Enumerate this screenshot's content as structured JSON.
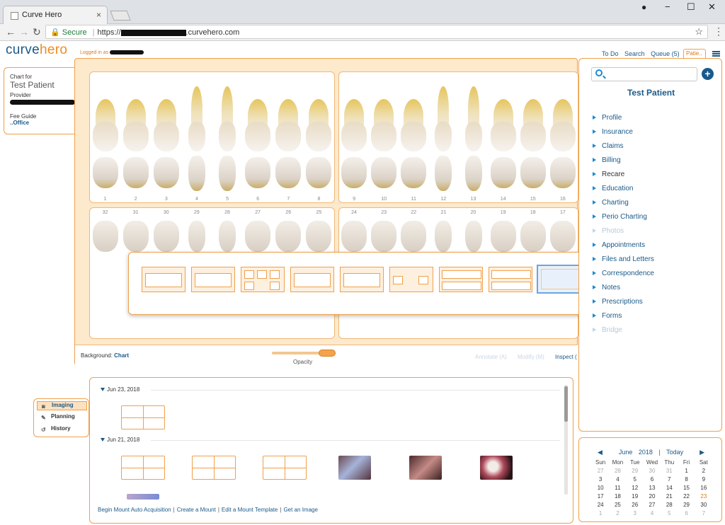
{
  "browser": {
    "tab_title": "Curve Hero",
    "tab_close": "×",
    "url_secure": "Secure",
    "url_proto": "https://",
    "url_domain": ".curvehero.com",
    "controls": [
      "−",
      "☐",
      "✕"
    ]
  },
  "app": {
    "logo_a": "curve",
    "logo_b": "hero",
    "logged_in": "Logged in as"
  },
  "topnav": {
    "todo": "To Do",
    "search": "Search",
    "queue": "Queue (5)",
    "patient_tab": "Patie.."
  },
  "chart_for": {
    "label": "Chart for",
    "patient": "Test Patient",
    "provider_label": "Provider",
    "fee_label": "Fee Guide",
    "fee_value": "..Office"
  },
  "tooth_numbers": {
    "upper": [
      "1",
      "2",
      "3",
      "4",
      "5",
      "6",
      "7",
      "8",
      "9",
      "10",
      "11",
      "12",
      "13",
      "14",
      "15",
      "16"
    ],
    "lower": [
      "32",
      "31",
      "30",
      "29",
      "28",
      "27",
      "26",
      "25",
      "24",
      "23",
      "22",
      "21",
      "20",
      "19",
      "18",
      "17"
    ]
  },
  "background": {
    "label": "Background:",
    "value": "Chart",
    "opacity_label": "Opacity",
    "opacity_level": 0.85
  },
  "actions": {
    "annotate": "Annotate (A)",
    "modify": "Modify (M)",
    "inspect": "Inspect ("
  },
  "right_panel": {
    "patient_name": "Test Patient",
    "search_placeholder": "",
    "menu": [
      {
        "label": "Profile",
        "state": "link"
      },
      {
        "label": "Insurance",
        "state": "link"
      },
      {
        "label": "Claims",
        "state": "link"
      },
      {
        "label": "Billing",
        "state": "link"
      },
      {
        "label": "Recare",
        "state": "plain"
      },
      {
        "label": "Education",
        "state": "link"
      },
      {
        "label": "Charting",
        "state": "link"
      },
      {
        "label": "Perio Charting",
        "state": "link"
      },
      {
        "label": "Photos",
        "state": "disabled"
      },
      {
        "label": "Appointments",
        "state": "link"
      },
      {
        "label": "Files and Letters",
        "state": "link"
      },
      {
        "label": "Correspondence",
        "state": "link"
      },
      {
        "label": "Notes",
        "state": "link"
      },
      {
        "label": "Prescriptions",
        "state": "link"
      },
      {
        "label": "Forms",
        "state": "link"
      },
      {
        "label": "Bridge",
        "state": "disabled"
      }
    ]
  },
  "calendar": {
    "month": "June",
    "year": "2018",
    "today_label": "Today",
    "sep": "|",
    "days": [
      "Sun",
      "Mon",
      "Tue",
      "Wed",
      "Thu",
      "Fri",
      "Sat"
    ],
    "weeks": [
      [
        "27",
        "28",
        "29",
        "30",
        "31",
        "1",
        "2"
      ],
      [
        "3",
        "4",
        "5",
        "6",
        "7",
        "8",
        "9"
      ],
      [
        "10",
        "11",
        "12",
        "13",
        "14",
        "15",
        "16"
      ],
      [
        "17",
        "18",
        "19",
        "20",
        "21",
        "22",
        "23"
      ],
      [
        "24",
        "25",
        "26",
        "27",
        "28",
        "29",
        "30"
      ],
      [
        "1",
        "2",
        "3",
        "4",
        "5",
        "6",
        "7"
      ]
    ],
    "today": "23"
  },
  "left_nav": {
    "items": [
      {
        "label": "Imaging",
        "icon": "camera-icon",
        "active": true
      },
      {
        "label": "Planning",
        "icon": "pencil-icon",
        "active": false
      },
      {
        "label": "History",
        "icon": "history-icon",
        "active": false
      }
    ]
  },
  "imaging": {
    "dates": [
      "Jun 23, 2018",
      "Jun 21, 2018"
    ],
    "links": [
      "Begin Mount Auto Acquisition",
      "Create a Mount",
      "Edit a Mount Template",
      "Get an Image"
    ],
    "sep": "|"
  },
  "colors": {
    "accent": "#f0a04b",
    "link": "#1a5a8a",
    "brand_orange": "#f08c22"
  }
}
